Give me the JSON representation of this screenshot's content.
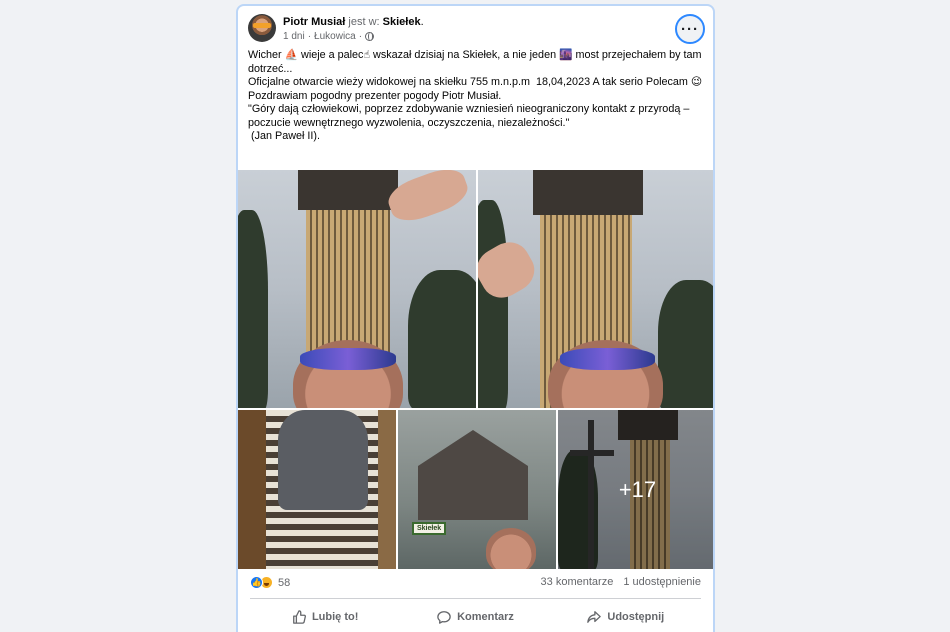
{
  "post": {
    "author": "Piotr Musiał",
    "location_prefix": "jest w:",
    "location": "Skiełek",
    "location_suffix": ".",
    "time": "1 dni",
    "place": "Łukowica",
    "privacy_icon": "globe-icon",
    "more_label": "···",
    "text": {
      "line1": "Wicher ⛵ wieje a palec☝ wskazał dzisiaj na Skiełek, a nie jeden 🌆 most przejechałem by tam dotrzeć...",
      "line2": "Oficjalne otwarcie wieży widokowej na skiełku 755 m.n.p.m  18,04,2023 A tak serio Polecam 😉",
      "line3": "Pozdrawiam pogodny prezenter pogody Piotr Musiał.",
      "line4": "\"Góry dają człowiekowi, poprzez zdobywanie wzniesień nieograniczony kontakt z przyrodą – poczucie wewnętrznego wyzwolenia, oczyszczenia, niezależności.\"",
      "line5": " (Jan Paweł II)."
    },
    "photos": {
      "sign_label": "Skiełek",
      "more_count": "+17"
    },
    "stats": {
      "reactions_count": "58",
      "comments": "33 komentarze",
      "shares": "1 udostępnienie"
    },
    "actions": {
      "like": "Lubię to!",
      "comment": "Komentarz",
      "share": "Udostępnij"
    }
  },
  "colors": {
    "accent": "#1877f2",
    "muted": "#65676b",
    "card_border": "#bcd6f7"
  }
}
